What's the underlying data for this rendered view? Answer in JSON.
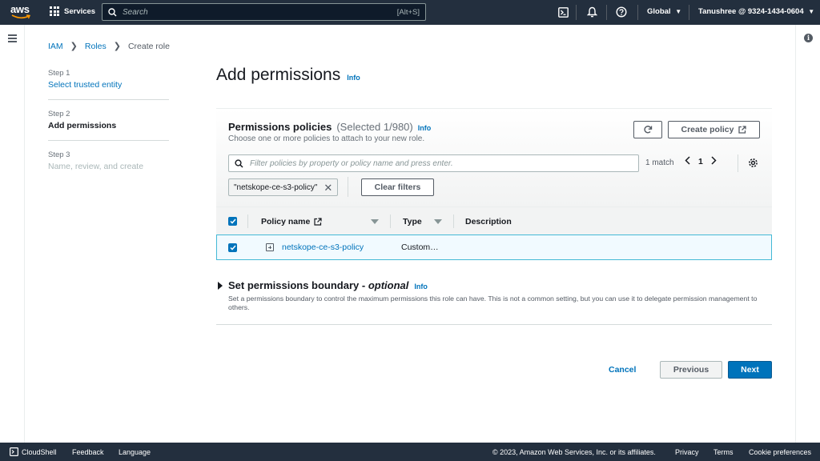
{
  "topnav": {
    "logo_text": "aws",
    "services_label": "Services",
    "search_placeholder": "Search",
    "search_shortcut": "[Alt+S]",
    "region": "Global",
    "account": "Tanushree @ 9324-1434-0604"
  },
  "breadcrumb": {
    "items": [
      "IAM",
      "Roles"
    ],
    "current": "Create role"
  },
  "steps": [
    {
      "num": "Step 1",
      "name": "Select trusted entity"
    },
    {
      "num": "Step 2",
      "name": "Add permissions"
    },
    {
      "num": "Step 3",
      "name": "Name, review, and create"
    }
  ],
  "page": {
    "title": "Add permissions",
    "info": "Info"
  },
  "permissions": {
    "title": "Permissions policies",
    "selected": "(Selected 1/980)",
    "info": "Info",
    "description": "Choose one or more policies to attach to your new role.",
    "create_policy": "Create policy",
    "filter_placeholder": "Filter policies by property or policy name and press enter.",
    "match_count": "1 match",
    "page": "1",
    "token": "\"netskope-ce-s3-policy\"",
    "clear_filters": "Clear filters",
    "columns": [
      "Policy name",
      "Type",
      "Description"
    ],
    "rows": [
      {
        "name": "netskope-ce-s3-policy",
        "type": "Custom…",
        "description": ""
      }
    ]
  },
  "boundary": {
    "title": "Set permissions boundary - ",
    "optional": "optional",
    "info": "Info",
    "description": "Set a permissions boundary to control the maximum permissions this role can have. This is not a common setting, but you can use it to delegate permission management to others."
  },
  "actions": {
    "cancel": "Cancel",
    "previous": "Previous",
    "next": "Next"
  },
  "footer": {
    "cloudshell": "CloudShell",
    "feedback": "Feedback",
    "language": "Language",
    "copyright": "© 2023, Amazon Web Services, Inc. or its affiliates.",
    "privacy": "Privacy",
    "terms": "Terms",
    "cookies": "Cookie preferences"
  },
  "colors": {
    "nav_bg": "#232f3e",
    "link": "#0073bb",
    "primary_button": "#0073bb",
    "row_selected_bg": "#f1faff",
    "row_selected_border": "#44b9d6"
  }
}
